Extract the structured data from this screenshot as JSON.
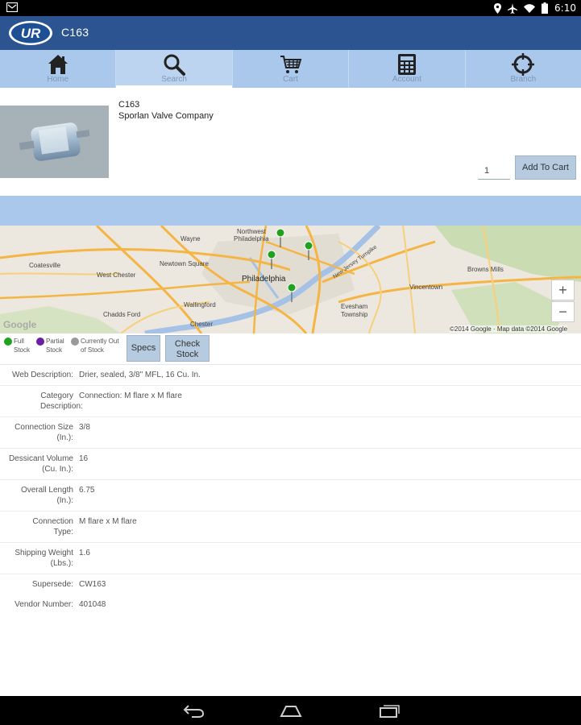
{
  "status_bar": {
    "time": "6:10",
    "icons": [
      "notification-icon",
      "location-icon",
      "airplane-icon",
      "wifi-icon",
      "battery-icon"
    ]
  },
  "app_bar": {
    "title": "C163",
    "logo": "UR"
  },
  "tabs": [
    {
      "label": "Home",
      "icon": "home-icon",
      "active": false
    },
    {
      "label": "Search",
      "icon": "search-icon",
      "active": true
    },
    {
      "label": "Cart",
      "icon": "cart-icon",
      "active": false
    },
    {
      "label": "Account",
      "icon": "account-icon",
      "active": false
    },
    {
      "label": "Branch",
      "icon": "branch-icon",
      "active": false
    }
  ],
  "product": {
    "code": "C163",
    "vendor": "Sporlan Valve Company",
    "quantity": "1",
    "add_to_cart_label": "Add To Cart"
  },
  "map": {
    "labels": {
      "northwest": "Northwest",
      "philadelphia_top": "Philadelphia",
      "wayne": "Wayne",
      "newtown_square": "Newtown Square",
      "west_chester": "West Chester",
      "coatesville": "Coatesville",
      "philadelphia": "Philadelphia",
      "wallingford": "Wallingford",
      "chadds_ford": "Chadds Ford",
      "chester": "Chester",
      "vincentown": "Vincentown",
      "evesham_township": "Evesham Township",
      "browns_mills": "Browns Mills",
      "nj_turnpike": "New Jersey Turnpike"
    },
    "copyright": "©2014 Google · Map data ©2014 Google",
    "google_logo": "Google",
    "zoom_in": "+",
    "zoom_out": "−"
  },
  "legend": {
    "full_stock": "Full Stock",
    "partial_stock": "Partial Stock",
    "out_of_stock": "Currently Out of Stock",
    "colors": {
      "full": "#1fa31f",
      "partial": "#6a1fa3",
      "out": "#9a9a9a"
    }
  },
  "buttons": {
    "specs": "Specs",
    "check_stock": "Check Stock"
  },
  "specs": [
    {
      "label": "Web Description:",
      "value": "Drier, sealed, 3/8\" MFL, 16 Cu. In."
    },
    {
      "label": "Category Description:",
      "value": "Connection: M flare x M flare"
    },
    {
      "label": "Connection Size (In.):",
      "value": "3/8"
    },
    {
      "label": "Dessicant Volume (Cu. In.):",
      "value": "16"
    },
    {
      "label": "Overall Length (In.):",
      "value": "6.75"
    },
    {
      "label": "Connection Type:",
      "value": "M flare x M flare"
    },
    {
      "label": "Shipping Weight (Lbs.):",
      "value": "1.6"
    },
    {
      "label": "Supersede:",
      "value": "CW163"
    },
    {
      "label": "Vendor Number:",
      "value": "401048"
    }
  ],
  "nav": [
    "back-icon",
    "home-nav-icon",
    "recents-icon"
  ]
}
